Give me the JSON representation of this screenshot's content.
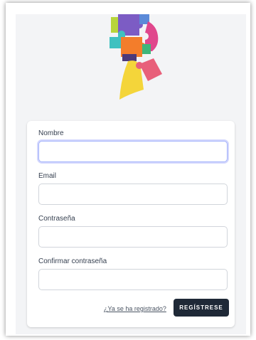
{
  "form": {
    "fields": [
      {
        "label": "Nombre",
        "value": ""
      },
      {
        "label": "Email",
        "value": ""
      },
      {
        "label": "Contraseña",
        "value": ""
      },
      {
        "label": "Confirmar contraseña",
        "value": ""
      }
    ],
    "login_link": "¿Ya se ha registrado?",
    "submit_label": "REGÍSTRESE"
  },
  "colors": {
    "background": "#f3f4f6",
    "card": "#ffffff",
    "button": "#1f2937",
    "focus_ring": "#a5b4fc"
  },
  "logo": {
    "icon": "puzzle-head-icon"
  }
}
